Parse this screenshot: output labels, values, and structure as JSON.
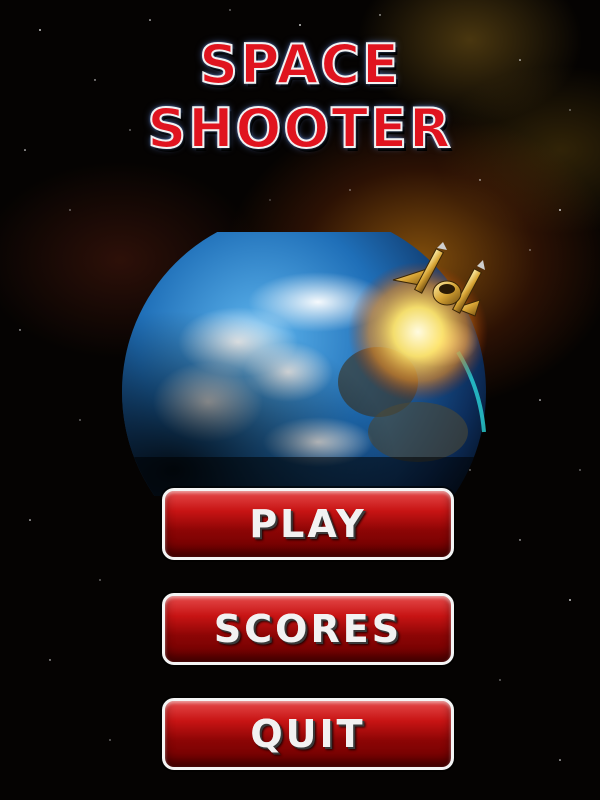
{
  "title": {
    "line1": "SPACE",
    "line2": "SHOOTER"
  },
  "menu": {
    "play": "PLAY",
    "scores": "SCORES",
    "quit": "QUIT"
  },
  "colors": {
    "title_red": "#e0141f",
    "button_red": "#c81414",
    "button_border": "#f4f4f4",
    "background": "#050302",
    "nebula_orange": "#e68c14"
  },
  "icons": {
    "planet": "earth-planet",
    "ship": "gold-spaceship",
    "explosion": "explosion-burst"
  }
}
